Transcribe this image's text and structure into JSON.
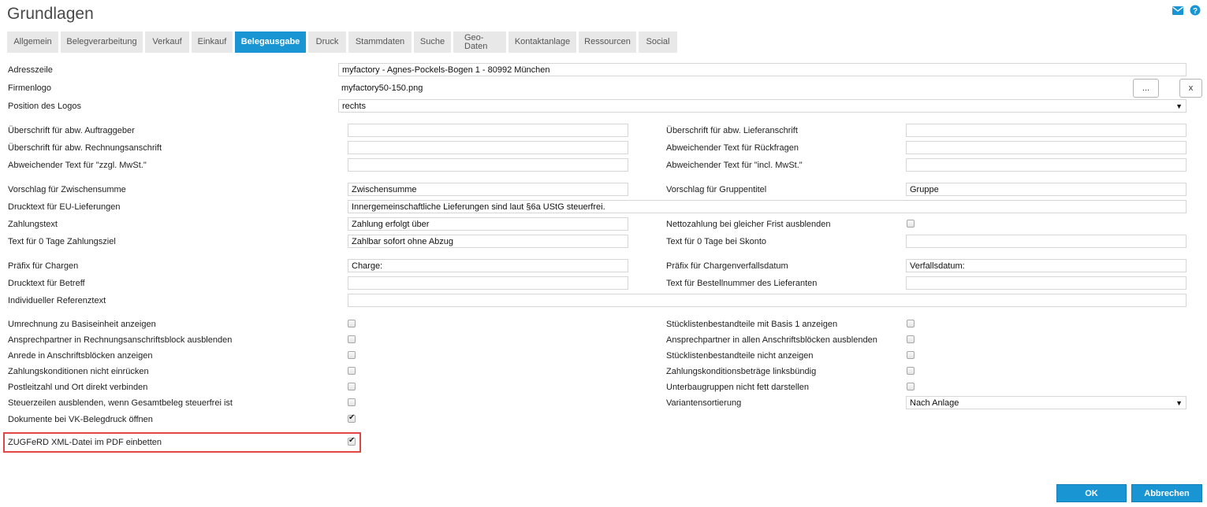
{
  "window": {
    "title": "Grundlagen"
  },
  "icons": {
    "mail": "mail-icon",
    "help": "help-icon"
  },
  "colors": {
    "accent": "#1a95d3",
    "highlight": "#e04646"
  },
  "tabs": [
    {
      "label": "Allgemein"
    },
    {
      "label": "Belegverarbeitung"
    },
    {
      "label": "Verkauf"
    },
    {
      "label": "Einkauf"
    },
    {
      "label": "Belegausgabe",
      "active": true
    },
    {
      "label": "Druck"
    },
    {
      "label": "Stammdaten"
    },
    {
      "label": "Suche"
    },
    {
      "label_line1": "Geo-",
      "label_line2": "Daten"
    },
    {
      "label": "Kontaktanlage"
    },
    {
      "label": "Ressourcen"
    },
    {
      "label": "Social"
    }
  ],
  "top": {
    "adresszeile_label": "Adresszeile",
    "adresszeile_value": "myfactory - Agnes-Pockels-Bogen 1 - 80992 München",
    "firmenlogo_label": "Firmenlogo",
    "firmenlogo_value": "myfactory50-150.png",
    "browse_label": "...",
    "clear_label": "x",
    "position_label": "Position des Logos",
    "position_value": "rechts"
  },
  "fields": {
    "ueb_auftraggeber_label": "Überschrift für abw. Auftraggeber",
    "ueb_auftraggeber_value": "",
    "ueb_lieferanschrift_label": "Überschrift für abw. Lieferanschrift",
    "ueb_lieferanschrift_value": "",
    "ueb_rechnungsanschrift_label": "Überschrift für abw. Rechnungsanschrift",
    "ueb_rechnungsanschrift_value": "",
    "abw_rueckfragen_label": "Abweichender Text für Rückfragen",
    "abw_rueckfragen_value": "",
    "abw_zzgl_label": "Abweichender Text für \"zzgl. MwSt.\"",
    "abw_zzgl_value": "",
    "abw_incl_label": "Abweichender Text für \"incl. MwSt.\"",
    "abw_incl_value": "",
    "zwischensumme_label": "Vorschlag für Zwischensumme",
    "zwischensumme_value": "Zwischensumme",
    "gruppentitel_label": "Vorschlag für Gruppentitel",
    "gruppentitel_value": "Gruppe",
    "eu_label": "Drucktext für EU-Lieferungen",
    "eu_value": "Innergemeinschaftliche Lieferungen sind laut §6a UStG steuerfrei.",
    "zahlungstext_label": "Zahlungstext",
    "zahlungstext_value": "Zahlung erfolgt über",
    "netto_label": "Nettozahlung bei gleicher Frist ausblenden",
    "text0_label": "Text für 0 Tage Zahlungsziel",
    "text0_value": "Zahlbar sofort ohne Abzug",
    "text0_skonto_label": "Text für 0 Tage bei Skonto",
    "text0_skonto_value": "",
    "chargen_label": "Präfix für Chargen",
    "chargen_value": "Charge:",
    "chargenverfall_label": "Präfix für Chargenverfallsdatum",
    "chargenverfall_value": "Verfallsdatum:",
    "betreff_label": "Drucktext für Betreff",
    "betreff_value": "",
    "bestellnr_label": "Text für Bestellnummer des Lieferanten",
    "bestellnr_value": "",
    "referenz_label": "Individueller Referenztext",
    "referenz_value": ""
  },
  "checkboxes_left": [
    {
      "label": "Umrechnung zu Basiseinheit anzeigen",
      "checked": false
    },
    {
      "label": "Ansprechpartner in Rechnungsanschriftsblock ausblenden",
      "checked": false
    },
    {
      "label": "Anrede in Anschriftsblöcken anzeigen",
      "checked": false
    },
    {
      "label": "Zahlungskonditionen nicht einrücken",
      "checked": false
    },
    {
      "label": "Postleitzahl und Ort direkt verbinden",
      "checked": false
    },
    {
      "label": "Steuerzeilen ausblenden, wenn Gesamtbeleg steuerfrei ist",
      "checked": false
    },
    {
      "label": "Dokumente bei VK-Belegdruck öffnen",
      "checked": true
    },
    {
      "label": "ZUGFeRD XML-Datei im PDF einbetten",
      "checked": true
    }
  ],
  "checkboxes_right": [
    {
      "label": "Stücklistenbestandteile mit Basis 1 anzeigen",
      "checked": false
    },
    {
      "label": "Ansprechpartner in allen Anschriftsblöcken ausblenden",
      "checked": false
    },
    {
      "label": "Stücklistenbestandteile nicht anzeigen",
      "checked": false
    },
    {
      "label": "Zahlungskonditionsbeträge linksbündig",
      "checked": false
    },
    {
      "label": "Unterbaugruppen nicht fett darstellen",
      "checked": false
    }
  ],
  "varianten": {
    "label": "Variantensortierung",
    "value": "Nach Anlage"
  },
  "footer": {
    "ok": "OK",
    "cancel": "Abbrechen"
  }
}
